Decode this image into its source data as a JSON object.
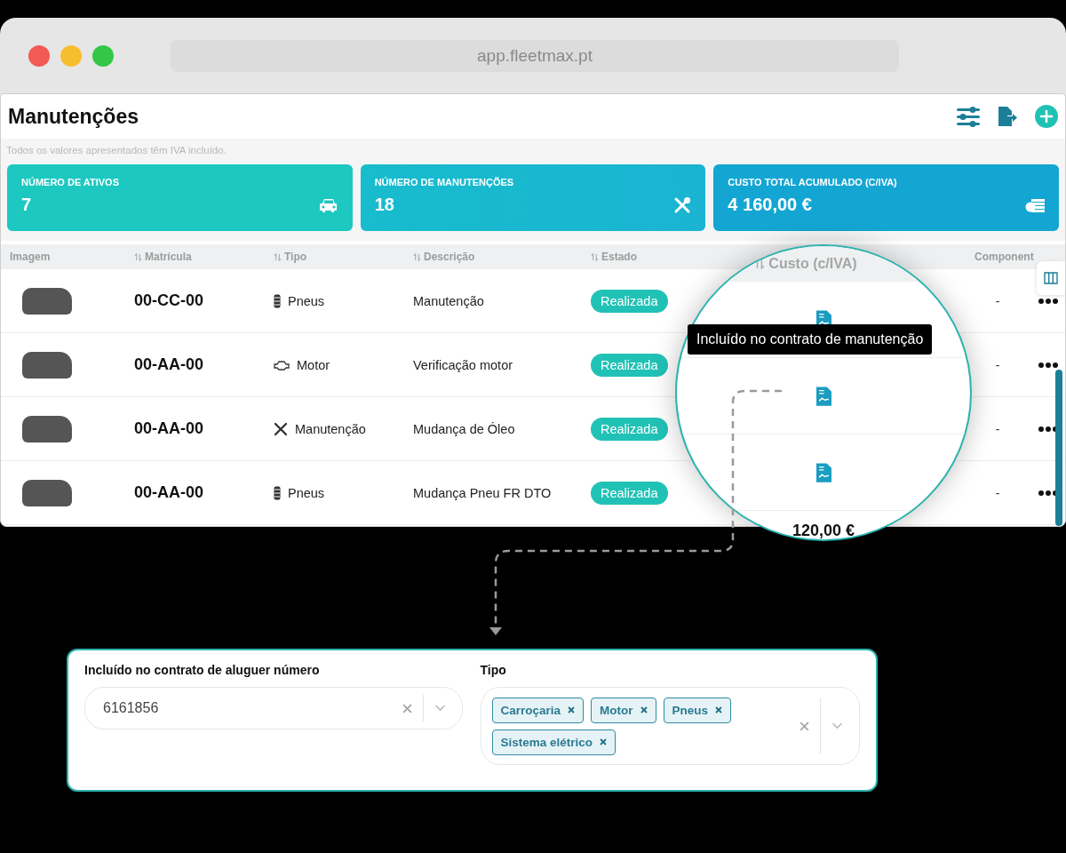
{
  "browser": {
    "url": "app.fleetmax.pt"
  },
  "page": {
    "title": "Manutenções",
    "note": "Todos os valores apresentados têm IVA incluído."
  },
  "stats": [
    {
      "label": "NÚMERO DE ATIVOS",
      "value": "7",
      "kind": "car"
    },
    {
      "label": "NÚMERO DE MANUTENÇÕES",
      "value": "18",
      "kind": "tools"
    },
    {
      "label": "CUSTO TOTAL ACUMULADO (C/IVA)",
      "value": "4 160,00 €",
      "kind": "money"
    }
  ],
  "table": {
    "columns": [
      {
        "label": "Imagem",
        "sortable": false
      },
      {
        "label": "Matrícula",
        "sortable": true
      },
      {
        "label": "Tipo",
        "sortable": true
      },
      {
        "label": "Descrição",
        "sortable": true
      },
      {
        "label": "Estado",
        "sortable": true
      },
      {
        "label": "Component",
        "sortable": false
      }
    ],
    "rows": [
      {
        "plate": "00-CC-00",
        "type": {
          "kind": "tire",
          "label": "Pneus"
        },
        "description": "Manutenção",
        "status": "Realizada",
        "component": "-"
      },
      {
        "plate": "00-AA-00",
        "type": {
          "kind": "engine",
          "label": "Motor"
        },
        "description": "Verificação motor",
        "status": "Realizada",
        "component": "-"
      },
      {
        "plate": "00-AA-00",
        "type": {
          "kind": "tools",
          "label": "Manutenção"
        },
        "description": "Mudança de Óleo",
        "status": "Realizada",
        "component": "-"
      },
      {
        "plate": "00-AA-00",
        "type": {
          "kind": "tire",
          "label": "Pneus"
        },
        "description": "Mudança Pneu FR DTO",
        "status": "Realizada",
        "component": "-"
      }
    ]
  },
  "magnifier": {
    "column": {
      "label": "Custo (c/IVA)",
      "sortable": true
    },
    "cells": [
      {
        "kind": "document"
      },
      {
        "kind": "document"
      },
      {
        "kind": "document"
      },
      {
        "kind": "amount",
        "text": "120,00 €"
      }
    ],
    "tooltip": "Incluído no contrato de manutenção"
  },
  "form": {
    "fields": [
      {
        "kind": "select",
        "label": "Incluído no contrato de aluguer número",
        "value": "6161856"
      },
      {
        "kind": "multiselect",
        "label": "Tipo",
        "tags": [
          "Carroçaria",
          "Motor",
          "Pneus",
          "Sistema elétrico"
        ]
      }
    ]
  }
}
